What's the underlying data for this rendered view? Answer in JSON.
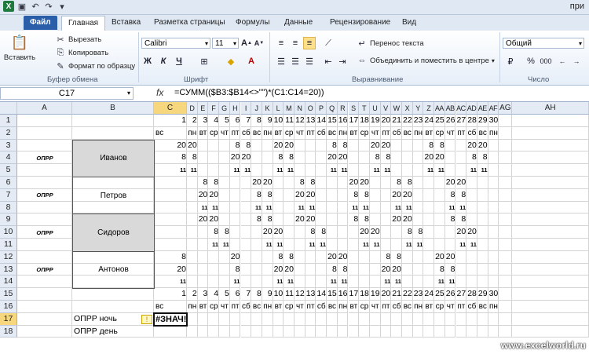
{
  "app": {
    "title": "при"
  },
  "ribbon_tabs": [
    "Файл",
    "Главная",
    "Вставка",
    "Разметка страницы",
    "Формулы",
    "Данные",
    "Рецензирование",
    "Вид"
  ],
  "clipboard": {
    "paste": "Вставить",
    "cut": "Вырезать",
    "copy": "Копировать",
    "format_painter": "Формат по образцу",
    "group": "Буфер обмена"
  },
  "font": {
    "name": "Calibri",
    "size": "11",
    "group": "Шрифт",
    "bold": "Ж",
    "italic": "К",
    "underline": "Ч"
  },
  "alignment": {
    "wrap": "Перенос текста",
    "merge": "Объединить и поместить в центре",
    "group": "Выравнивание"
  },
  "number": {
    "format": "Общий",
    "group": "Число",
    "percent": "%",
    "thousands": "000"
  },
  "formula_bar": {
    "namebox": "C17",
    "fx": "fx",
    "formula": "=СУММ(($B3:$B14<>\"\")*(C1:C14=20))"
  },
  "columns": [
    "A",
    "B",
    "C",
    "D",
    "E",
    "F",
    "G",
    "H",
    "I",
    "J",
    "K",
    "L",
    "M",
    "N",
    "O",
    "P",
    "Q",
    "R",
    "S",
    "T",
    "U",
    "V",
    "W",
    "X",
    "Y",
    "Z",
    "AA",
    "AB",
    "AC",
    "AD",
    "AE",
    "AF",
    "AG",
    "AH"
  ],
  "rows": [
    "1",
    "2",
    "3",
    "4",
    "5",
    "6",
    "7",
    "8",
    "9",
    "10",
    "11",
    "12",
    "13",
    "14",
    "15",
    "16",
    "17",
    "18"
  ],
  "days": [
    "1",
    "2",
    "3",
    "4",
    "5",
    "6",
    "7",
    "8",
    "9",
    "10",
    "11",
    "12",
    "13",
    "14",
    "15",
    "16",
    "17",
    "18",
    "19",
    "20",
    "21",
    "22",
    "23",
    "24",
    "25",
    "26",
    "27",
    "28",
    "29",
    "30"
  ],
  "weekdays": [
    "вс",
    "пн",
    "вт",
    "ср",
    "чт",
    "пт",
    "сб",
    "вс",
    "пн",
    "вт",
    "ср",
    "чт",
    "пт",
    "сб",
    "вс",
    "пн",
    "вт",
    "ср",
    "чт",
    "пт",
    "сб",
    "вс",
    "пн",
    "вт",
    "ср",
    "чт",
    "пт",
    "сб",
    "вс",
    "пн"
  ],
  "people": [
    {
      "label": "ОПРР",
      "name": "Иванов"
    },
    {
      "label": "ОПРР",
      "name": "Петров"
    },
    {
      "label": "ОПРР",
      "name": "Сидоров"
    },
    {
      "label": "ОПРР",
      "name": "Антонов"
    }
  ],
  "schedule": [
    [
      "20",
      "20",
      "",
      "",
      "",
      "8",
      "8",
      "",
      "",
      "20",
      "20",
      "",
      "",
      "",
      "8",
      "8",
      "",
      "",
      "20",
      "20",
      "",
      "",
      "",
      "8",
      "8",
      "",
      "",
      "20",
      "20",
      ""
    ],
    [
      "8",
      "8",
      "",
      "",
      "",
      "20",
      "20",
      "",
      "",
      "8",
      "8",
      "",
      "",
      "",
      "20",
      "20",
      "",
      "",
      "8",
      "8",
      "",
      "",
      "",
      "20",
      "20",
      "",
      "",
      "8",
      "8",
      ""
    ],
    [
      "11",
      "11",
      "",
      "",
      "",
      "11",
      "11",
      "",
      "",
      "11",
      "11",
      "",
      "",
      "",
      "11",
      "11",
      "",
      "",
      "11",
      "11",
      "",
      "",
      "",
      "11",
      "11",
      "",
      "",
      "11",
      "11",
      ""
    ],
    [
      "",
      "",
      "8",
      "8",
      "",
      "",
      "",
      "20",
      "20",
      "",
      "",
      "8",
      "8",
      "",
      "",
      "",
      "20",
      "20",
      "",
      "",
      "8",
      "8",
      "",
      "",
      "",
      "20",
      "20",
      "",
      "",
      ""
    ],
    [
      "",
      "",
      "20",
      "20",
      "",
      "",
      "",
      "8",
      "8",
      "",
      "",
      "20",
      "20",
      "",
      "",
      "",
      "8",
      "8",
      "",
      "",
      "20",
      "20",
      "",
      "",
      "",
      "8",
      "8",
      "",
      "",
      ""
    ],
    [
      "",
      "",
      "11",
      "11",
      "",
      "",
      "",
      "11",
      "11",
      "",
      "",
      "11",
      "11",
      "",
      "",
      "",
      "11",
      "11",
      "",
      "",
      "11",
      "11",
      "",
      "",
      "",
      "11",
      "11",
      "",
      "",
      ""
    ],
    [
      "",
      "",
      "20",
      "20",
      "",
      "",
      "",
      "8",
      "8",
      "",
      "",
      "20",
      "20",
      "",
      "",
      "",
      "8",
      "8",
      "",
      "",
      "20",
      "20",
      "",
      "",
      "",
      "8",
      "8",
      "",
      "",
      ""
    ],
    [
      "",
      "",
      "",
      "8",
      "8",
      "",
      "",
      "",
      "20",
      "20",
      "",
      "",
      "8",
      "8",
      "",
      "",
      "",
      "20",
      "20",
      "",
      "",
      "8",
      "8",
      "",
      "",
      "",
      "20",
      "20",
      "",
      ""
    ],
    [
      "",
      "",
      "",
      "11",
      "11",
      "",
      "",
      "",
      "11",
      "11",
      "",
      "",
      "11",
      "11",
      "",
      "",
      "",
      "11",
      "11",
      "",
      "",
      "11",
      "11",
      "",
      "",
      "",
      "11",
      "11",
      "",
      ""
    ],
    [
      "8",
      "",
      "",
      "",
      "",
      "20",
      "",
      "",
      "",
      "8",
      "8",
      "",
      "",
      "",
      "20",
      "20",
      "",
      "",
      "",
      "8",
      "8",
      "",
      "",
      "",
      "20",
      "20",
      "",
      "",
      "",
      ""
    ],
    [
      "20",
      "",
      "",
      "",
      "",
      "8",
      "",
      "",
      "",
      "20",
      "20",
      "",
      "",
      "",
      "8",
      "8",
      "",
      "",
      "",
      "20",
      "20",
      "",
      "",
      "",
      "8",
      "8",
      "",
      "",
      "",
      ""
    ],
    [
      "11",
      "",
      "",
      "",
      "",
      "11",
      "",
      "",
      "",
      "11",
      "11",
      "",
      "",
      "",
      "11",
      "11",
      "",
      "",
      "",
      "11",
      "11",
      "",
      "",
      "",
      "11",
      "11",
      "",
      "",
      "",
      ""
    ]
  ],
  "summary": {
    "night_label": "ОПРР ночь",
    "day_label": "ОПРР день",
    "error_value": "#ЗНАЧ!",
    "warn_icon": "warning-diamond-icon",
    "warn_glyph": "!"
  },
  "watermark": "www.excelworld.ru"
}
